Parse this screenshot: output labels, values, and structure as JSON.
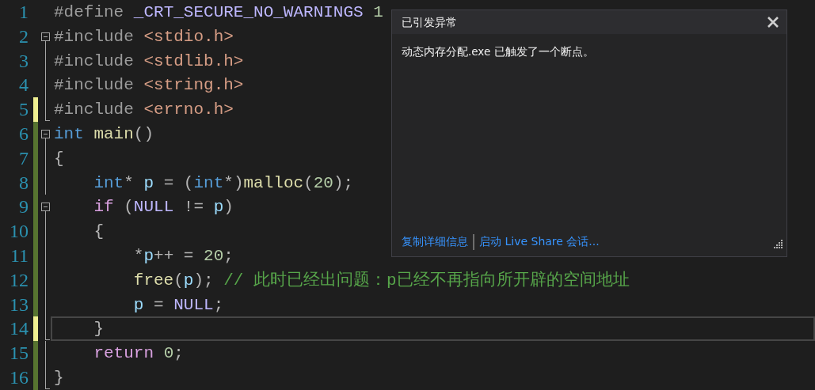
{
  "editor": {
    "lines": [
      {
        "number": "1",
        "current": false,
        "tokens": [
          {
            "kind": "preprocessor",
            "text": "#define "
          },
          {
            "kind": "macro",
            "text": "_CRT_SECURE_NO_WARNINGS"
          },
          {
            "kind": "number",
            "text": " 1"
          }
        ]
      },
      {
        "number": "2",
        "current": false,
        "expanded": true,
        "tokens": [
          {
            "kind": "preprocessor",
            "text": "#include "
          },
          {
            "kind": "string",
            "text": "<stdio.h>"
          }
        ],
        "children": [
          {
            "number": "3",
            "current": false,
            "tokens": [
              {
                "kind": "preprocessor",
                "text": "#include "
              },
              {
                "kind": "string",
                "text": "<stdlib.h>"
              }
            ]
          },
          {
            "number": "4",
            "current": false,
            "tokens": [
              {
                "kind": "preprocessor",
                "text": "#include "
              },
              {
                "kind": "string",
                "text": "<string.h>"
              }
            ]
          },
          {
            "number": "5",
            "current": false,
            "color": "#efef91",
            "tokens": [
              {
                "kind": "preprocessor",
                "text": "#include "
              },
              {
                "kind": "string",
                "text": "<errno.h>"
              }
            ]
          }
        ]
      },
      {
        "number": "6",
        "current": false,
        "color": "#577430",
        "expanded": true,
        "tokens": [
          {
            "kind": "keyword",
            "text": "int"
          },
          {
            "kind": "function",
            "text": " main"
          },
          {
            "kind": "punct",
            "text": "()"
          }
        ],
        "children": [
          {
            "number": "7",
            "current": false,
            "color": "#577430",
            "tokens": [
              {
                "kind": "punct",
                "text": "{"
              }
            ]
          },
          {
            "number": "8",
            "current": false,
            "color": "#577430",
            "tokens": [
              {
                "kind": "keyword",
                "text": "    int"
              },
              {
                "kind": "punct",
                "text": "* "
              },
              {
                "kind": "variable",
                "text": "p"
              },
              {
                "kind": "punct",
                "text": " = ("
              },
              {
                "kind": "keyword",
                "text": "int"
              },
              {
                "kind": "punct",
                "text": "*)"
              },
              {
                "kind": "function",
                "text": "malloc"
              },
              {
                "kind": "punct",
                "text": "("
              },
              {
                "kind": "number",
                "text": "20"
              },
              {
                "kind": "punct",
                "text": ");"
              }
            ]
          },
          {
            "number": "9",
            "current": false,
            "color": "#577430",
            "expanded": true,
            "tokens": [
              {
                "kind": "control",
                "text": "    if"
              },
              {
                "kind": "punct",
                "text": " ("
              },
              {
                "kind": "macro",
                "text": "NULL"
              },
              {
                "kind": "punct",
                "text": " != "
              },
              {
                "kind": "variable",
                "text": "p"
              },
              {
                "kind": "punct",
                "text": ")"
              }
            ],
            "children": [
              {
                "number": "10",
                "current": false,
                "color": "#577430",
                "tokens": [
                  {
                    "kind": "punct",
                    "text": "    {"
                  }
                ]
              },
              {
                "number": "11",
                "current": false,
                "color": "#577430",
                "tokens": [
                  {
                    "kind": "punct",
                    "text": "        *"
                  },
                  {
                    "kind": "variable",
                    "text": "p"
                  },
                  {
                    "kind": "punct",
                    "text": "++ = "
                  },
                  {
                    "kind": "number",
                    "text": "20"
                  },
                  {
                    "kind": "punct",
                    "text": ";"
                  }
                ]
              },
              {
                "number": "12",
                "current": false,
                "color": "#577430",
                "tokens": [
                  {
                    "kind": "function",
                    "text": "        free"
                  },
                  {
                    "kind": "punct",
                    "text": "("
                  },
                  {
                    "kind": "variable",
                    "text": "p"
                  },
                  {
                    "kind": "punct",
                    "text": "); "
                  },
                  {
                    "kind": "comment",
                    "text": "// 此时已经出问题：p已经不再指向所开辟的空间地址"
                  }
                ]
              },
              {
                "number": "13",
                "current": false,
                "color": "#577430",
                "tokens": [
                  {
                    "kind": "variable",
                    "text": "        p"
                  },
                  {
                    "kind": "punct",
                    "text": " = "
                  },
                  {
                    "kind": "macro",
                    "text": "NULL"
                  },
                  {
                    "kind": "punct",
                    "text": ";"
                  }
                ]
              },
              {
                "number": "14",
                "current": true,
                "color": "#efef91",
                "tokens": [
                  {
                    "kind": "punct",
                    "text": "    }"
                  }
                ]
              }
            ]
          },
          {
            "number": "15",
            "current": false,
            "color": "#577430",
            "tokens": [
              {
                "kind": "control",
                "text": "    return"
              },
              {
                "kind": "number",
                "text": " 0"
              },
              {
                "kind": "punct",
                "text": ";"
              }
            ]
          },
          {
            "number": "16",
            "current": false,
            "color": "#577430",
            "tokens": [
              {
                "kind": "punct",
                "text": "}"
              }
            ]
          }
        ]
      }
    ]
  },
  "exception_popup": {
    "title": "已引发异常",
    "message": "动态内存分配.exe 已触发了一个断点。",
    "links": [
      "复制详细信息",
      "启动 Live Share 会话..."
    ]
  }
}
